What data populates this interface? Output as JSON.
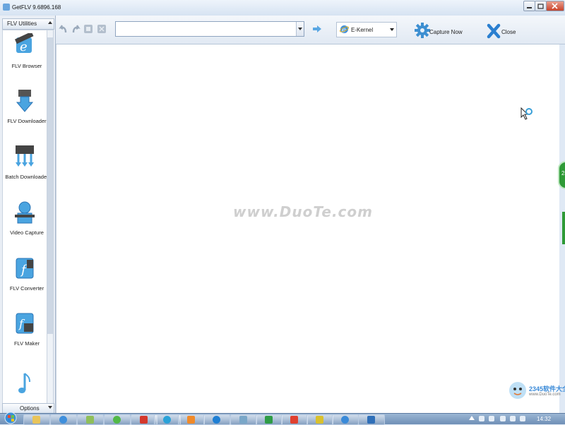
{
  "window": {
    "title": "GetFLV 9.6896.168"
  },
  "sidebar": {
    "header": "FLV Utilities",
    "footer": "Options",
    "items": [
      {
        "label": "FLV Browser",
        "icon": "flv-browser-icon"
      },
      {
        "label": "FLV Downloader",
        "icon": "flv-downloader-icon"
      },
      {
        "label": "Batch Downloader",
        "icon": "batch-downloader-icon"
      },
      {
        "label": "Video Capture",
        "icon": "video-capture-icon"
      },
      {
        "label": "FLV Converter",
        "icon": "flv-converter-icon"
      },
      {
        "label": "FLV Maker",
        "icon": "flv-maker-icon"
      }
    ]
  },
  "toolbar": {
    "url_value": "",
    "kernel_label": "E-Kernel",
    "capture_label": "Capture Now",
    "close_label": "Close"
  },
  "content": {
    "watermark": "www.DuoTe.com"
  },
  "side_tab": {
    "label": "24"
  },
  "brand": {
    "name": "2345软件大全",
    "url": "www.DuoTe.com"
  },
  "taskbar": {
    "clock": "14:32"
  },
  "colors": {
    "accent": "#3a8ad8",
    "green": "#2e9a37",
    "gear": "#3d8fd1",
    "close_x": "#2a7fd0"
  }
}
